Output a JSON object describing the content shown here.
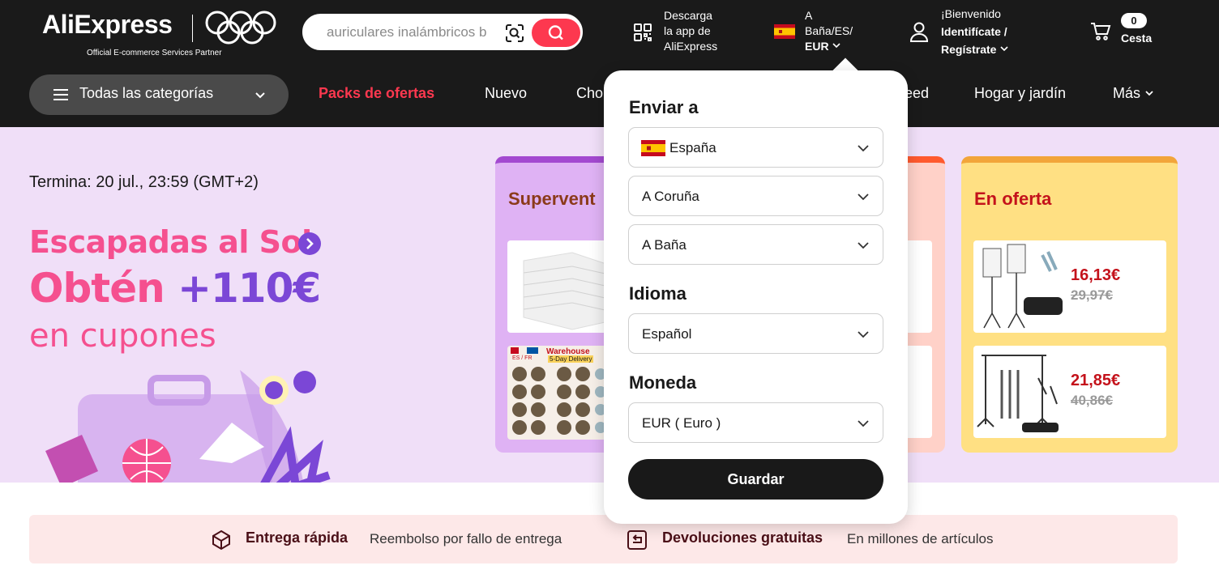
{
  "header": {
    "logo_text": "AliExpress",
    "partner_text": "Official E-commerce Services Partner",
    "search": {
      "value": "auriculares inalámbricos b"
    },
    "app_download": {
      "line1": "Descarga",
      "line2": "la app de",
      "line3": "AliExpress"
    },
    "region": {
      "line1": "A",
      "line2": "Baña/ES/",
      "line3": "EUR"
    },
    "account": {
      "greeting": "¡Bienvenido",
      "signin": "Identifícate /",
      "register": "Regístrate"
    },
    "cart": {
      "count": "0",
      "label": "Cesta"
    }
  },
  "nav": {
    "categories_label": "Todas las categorías",
    "items": [
      "Packs de ofertas",
      "Nuevo",
      "Cho",
      "eed",
      "Hogar y jardín",
      "Más"
    ]
  },
  "hero": {
    "ends": "Termina: 20 jul., 23:59 (GMT+2)",
    "headline": "Escapadas al Sol",
    "offer_part1": "Obtén ",
    "offer_part2": "+110€",
    "offer_sub": "en cupones"
  },
  "cards": {
    "purple_title": "Supervent",
    "yellow_title": "En oferta",
    "warehouse": {
      "label": "Warehouse",
      "sub": "5-Day Delivery",
      "flags": "ES / FR"
    },
    "products": [
      {
        "price": "16,13€",
        "old_price": "29,97€"
      },
      {
        "price": "21,85€",
        "old_price": "40,86€"
      }
    ]
  },
  "popup": {
    "ship_to_title": "Enviar a",
    "country": "España",
    "province": "A Coruña",
    "city": "A Baña",
    "language_title": "Idioma",
    "language": "Español",
    "currency_title": "Moneda",
    "currency": "EUR ( Euro )",
    "save_label": "Guardar"
  },
  "strip": {
    "fast_title": "Entrega rápida",
    "fast_desc": "Reembolso por fallo de entrega",
    "returns_title": "Devoluciones gratuitas",
    "returns_desc": "En millones de artículos"
  },
  "colors": {
    "brand_red": "#fd384f",
    "header_bg": "#1a1a1a",
    "hero_bg": "#f0dff8",
    "accent_purple": "#7b47d6",
    "accent_pink": "#f5508f"
  }
}
